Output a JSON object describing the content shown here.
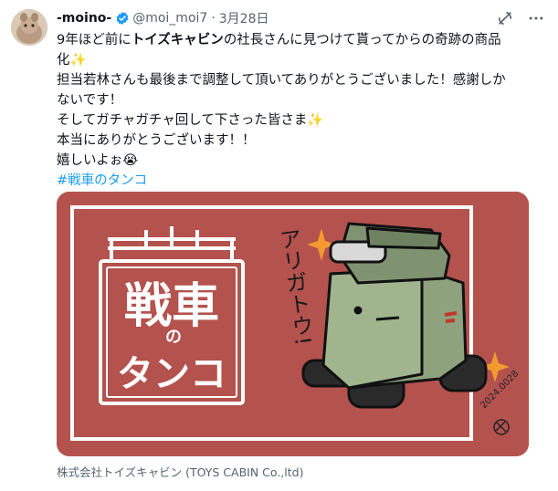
{
  "author": {
    "display_name": "-moino-",
    "handle": "@moi_moi7",
    "separator": "·",
    "date": "3月28日"
  },
  "tweet": {
    "line1_pre": "9年ほど前に",
    "line1_bold": "トイズキャビン",
    "line1_post": "の社長さんに見つけて貰ってからの奇跡の商品",
    "line2": "化✨",
    "line3": "担当若林さんも最後まで調整して頂いてありがとうございました！感謝しか",
    "line4": "ないです！",
    "line5": "そしてガチャガチャ回して下さった皆さま✨",
    "line6": "本当にありがとうございます！！",
    "line7": "嬉しいよぉ😭",
    "hashtag": "#戦車のタンコ"
  },
  "card": {
    "logo_title": "戦車",
    "logo_no": "の",
    "logo_sub": "タンコ",
    "art_text": "アリガトウ!",
    "signature_date": "2024.0028",
    "caption": "株式会社トイズキャビン (TOYS CABIN Co.,ltd)"
  },
  "icons": {
    "verified": "verified-badge-icon",
    "grok": "grok-icon",
    "more": "more-icon"
  },
  "colors": {
    "card_bg": "#b4524e",
    "accent": "#1d9bf0",
    "tank_green": "#8ea27d",
    "sparkle": "#f39a2e"
  }
}
